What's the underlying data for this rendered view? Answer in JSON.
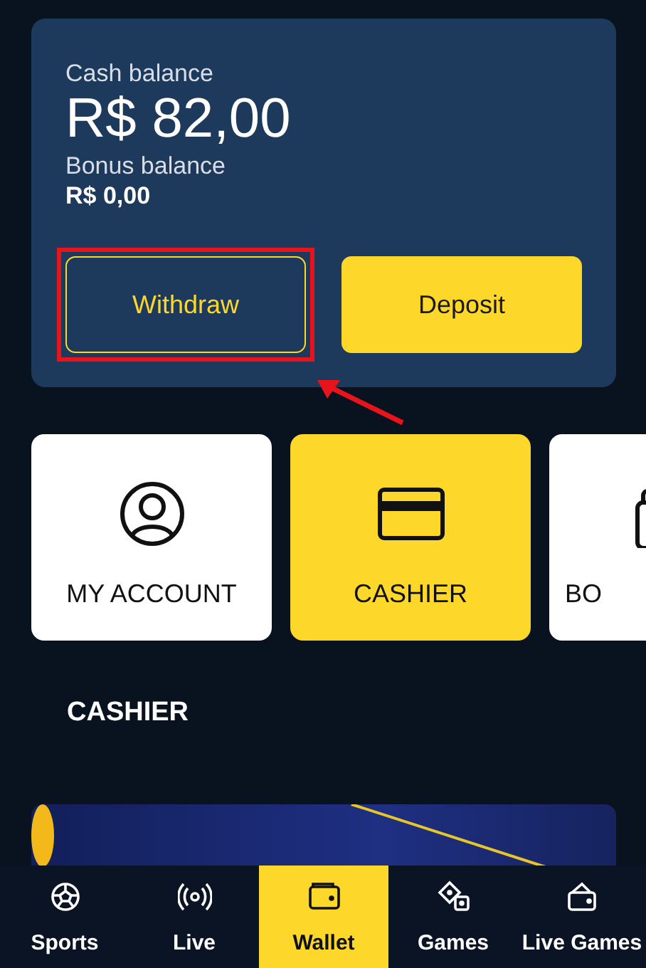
{
  "balance": {
    "cash_label": "Cash balance",
    "cash_amount": "R$ 82,00",
    "bonus_label": "Bonus balance",
    "bonus_amount": "R$ 0,00",
    "buttons": [
      {
        "label": "Withdraw",
        "kind": "outline",
        "highlighted": true
      },
      {
        "label": "Deposit",
        "kind": "filled",
        "highlighted": false
      }
    ]
  },
  "tiles": [
    {
      "label": "MY ACCOUNT",
      "selected": false
    },
    {
      "label": "CASHIER",
      "selected": true
    },
    {
      "label": "BO",
      "selected": false
    }
  ],
  "section_title": "CASHIER",
  "nav": [
    {
      "label": "Sports",
      "selected": false
    },
    {
      "label": "Live",
      "selected": false
    },
    {
      "label": "Wallet",
      "selected": true
    },
    {
      "label": "Games",
      "selected": false
    },
    {
      "label": "Live Games",
      "selected": false
    }
  ]
}
